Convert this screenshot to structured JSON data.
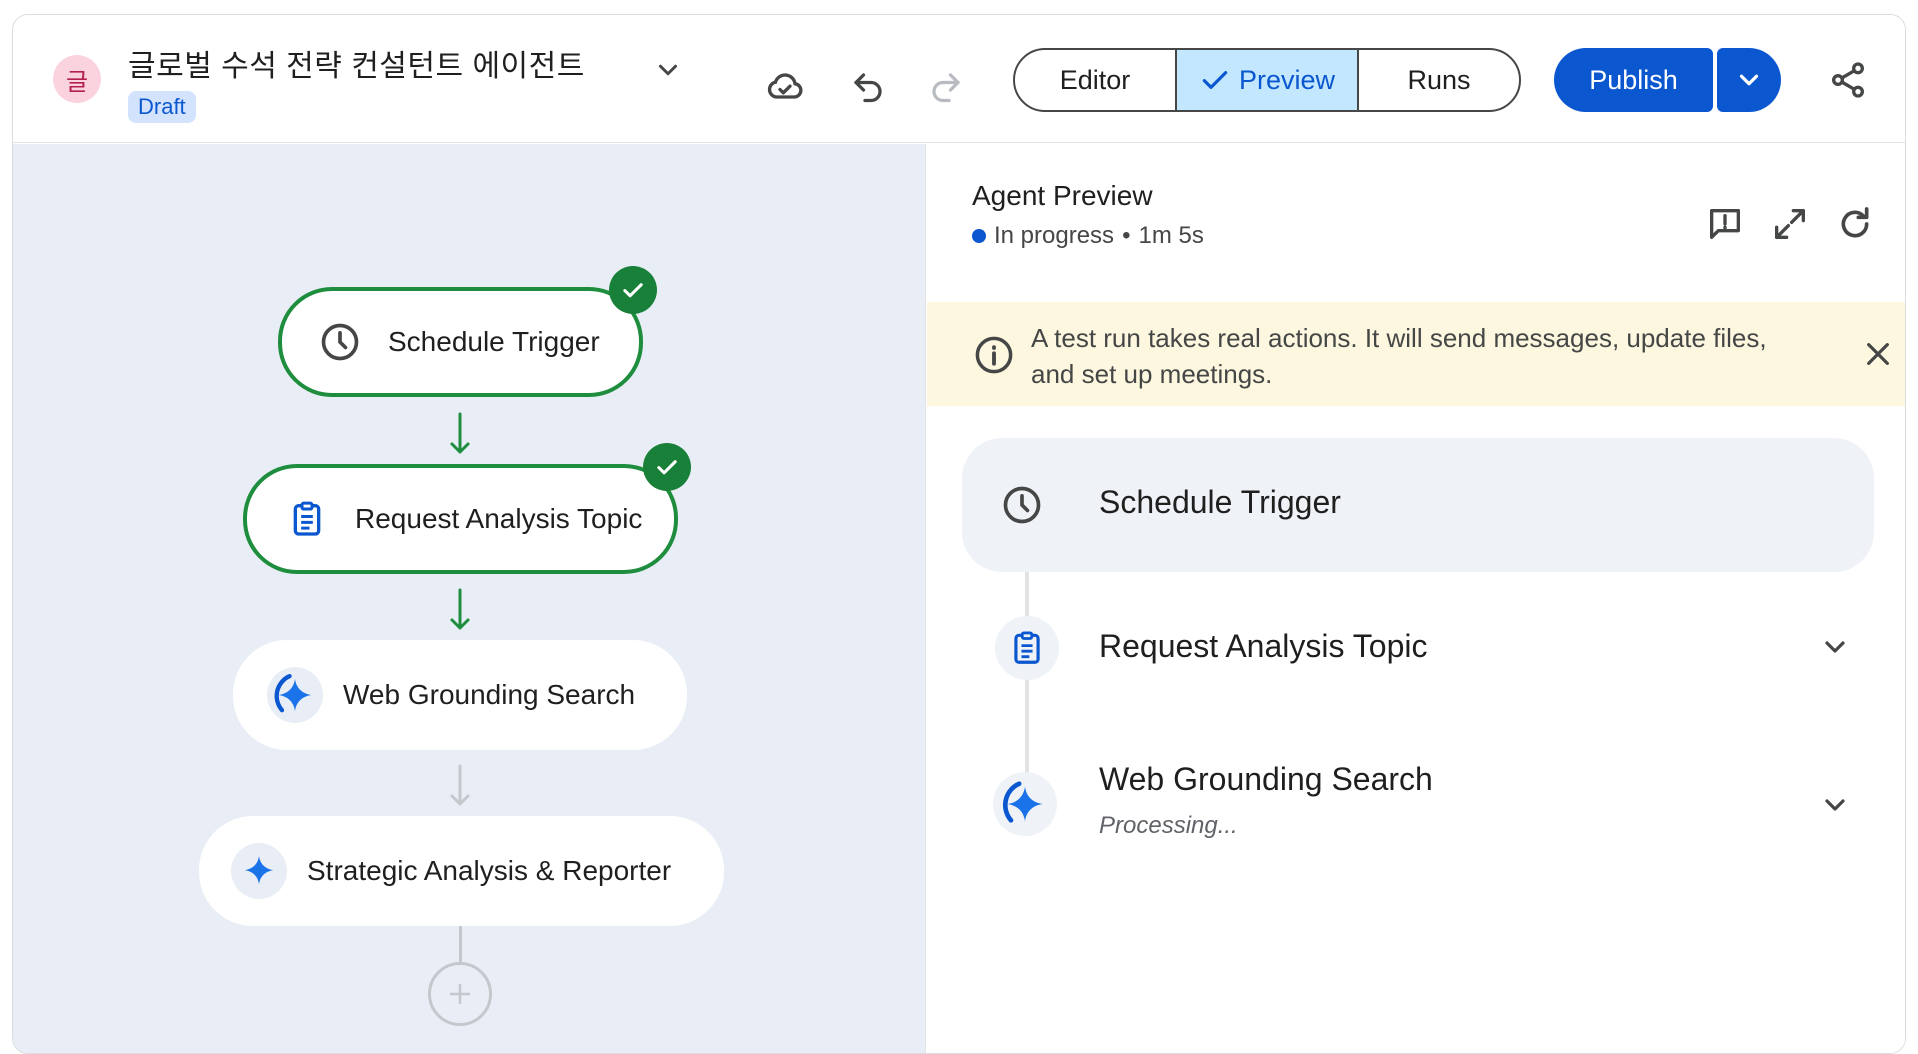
{
  "header": {
    "avatar_letter": "글",
    "title": "글로벌 수석 전략 컨설턴트 에이전트",
    "draft_badge": "Draft",
    "tabs": {
      "editor": "Editor",
      "preview": "Preview",
      "runs": "Runs"
    },
    "publish_label": "Publish"
  },
  "canvas": {
    "nodes": [
      {
        "label": "Schedule Trigger",
        "status": "done"
      },
      {
        "label": "Request Analysis Topic",
        "status": "done"
      },
      {
        "label": "Web Grounding Search",
        "status": "active"
      },
      {
        "label": "Strategic Analysis & Reporter",
        "status": "pending"
      }
    ]
  },
  "preview": {
    "title": "Agent Preview",
    "status": "In progress",
    "separator": "•",
    "elapsed": "1m 5s",
    "banner_text": "A test run takes real actions. It will send messages, update files, and set up meetings.",
    "steps": [
      {
        "label": "Schedule Trigger",
        "sub": ""
      },
      {
        "label": "Request Analysis Topic",
        "sub": ""
      },
      {
        "label": "Web Grounding Search",
        "sub": "Processing..."
      }
    ]
  },
  "colors": {
    "accent": "#0b57d0",
    "success": "#188038",
    "canvas_bg": "#e9eef6",
    "banner_bg": "#fef7e0"
  }
}
